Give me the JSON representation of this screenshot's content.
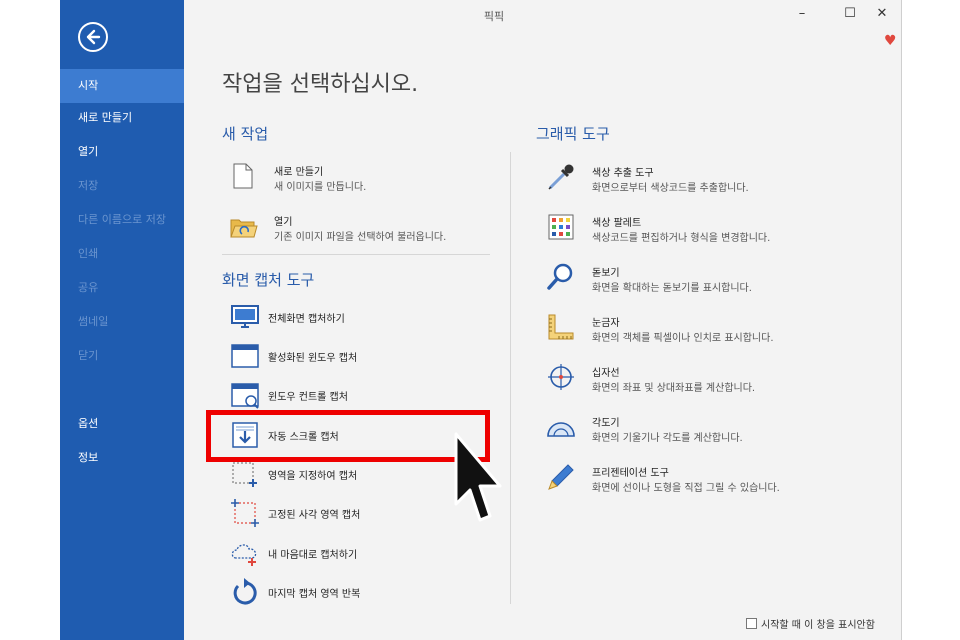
{
  "app": {
    "title": "픽픽"
  },
  "window_controls": {
    "minimize": "–",
    "maximize": "☐",
    "close": "✕"
  },
  "sidebar": {
    "items": [
      {
        "label": "시작",
        "state": "active"
      },
      {
        "label": "새로 만들기",
        "state": "normal"
      },
      {
        "label": "열기",
        "state": "normal"
      },
      {
        "label": "저장",
        "state": "disabled"
      },
      {
        "label": "다른 이름으로 저장",
        "state": "disabled"
      },
      {
        "label": "인쇄",
        "state": "disabled"
      },
      {
        "label": "공유",
        "state": "disabled"
      },
      {
        "label": "썸네일",
        "state": "disabled"
      },
      {
        "label": "닫기",
        "state": "disabled"
      },
      {
        "label": "옵션",
        "state": "normal"
      },
      {
        "label": "정보",
        "state": "normal"
      }
    ]
  },
  "main": {
    "title": "작업을 선택하십시오.",
    "new_task": {
      "heading": "새 작업",
      "items": [
        {
          "title": "새로 만들기",
          "desc": "새 이미지를 만듭니다."
        },
        {
          "title": "열기",
          "desc": "기존 이미지 파일을 선택하여 불러옵니다."
        }
      ]
    },
    "capture": {
      "heading": "화면 캡처 도구",
      "items": [
        {
          "title": "전체화면 캡처하기"
        },
        {
          "title": "활성화된 윈도우 캡처"
        },
        {
          "title": "윈도우 컨트롤 캡처"
        },
        {
          "title": "자동 스크롤 캡처"
        },
        {
          "title": "영역을 지정하여 캡처"
        },
        {
          "title": "고정된 사각 영역 캡처"
        },
        {
          "title": "내 마음대로 캡처하기"
        },
        {
          "title": "마지막 캡처 영역 반복"
        }
      ]
    },
    "graphic": {
      "heading": "그래픽 도구",
      "items": [
        {
          "title": "색상 추출 도구",
          "desc": "화면으로부터 색상코드를 추출합니다."
        },
        {
          "title": "색상 팔레트",
          "desc": "색상코드를 편집하거나 형식을 변경합니다."
        },
        {
          "title": "돋보기",
          "desc": "화면을 확대하는 돋보기를 표시합니다."
        },
        {
          "title": "눈금자",
          "desc": "화면의 객체를 픽셀이나 인치로 표시합니다."
        },
        {
          "title": "십자선",
          "desc": "화면의 좌표 및 상대좌표를 계산합니다."
        },
        {
          "title": "각도기",
          "desc": "화면의 기울기나 각도를 계산합니다."
        },
        {
          "title": "프리젠테이션 도구",
          "desc": "화면에 선이나 도형을 직접 그릴 수 있습니다."
        }
      ]
    }
  },
  "footer": {
    "checkbox_label": "시작할 때 이 창을 표시안함",
    "checked": false
  },
  "colors": {
    "sidebar": "#1f5cb0",
    "sidebar_active": "#3d7cd1",
    "accent": "#2a5caa",
    "highlight": "#ee0000"
  }
}
